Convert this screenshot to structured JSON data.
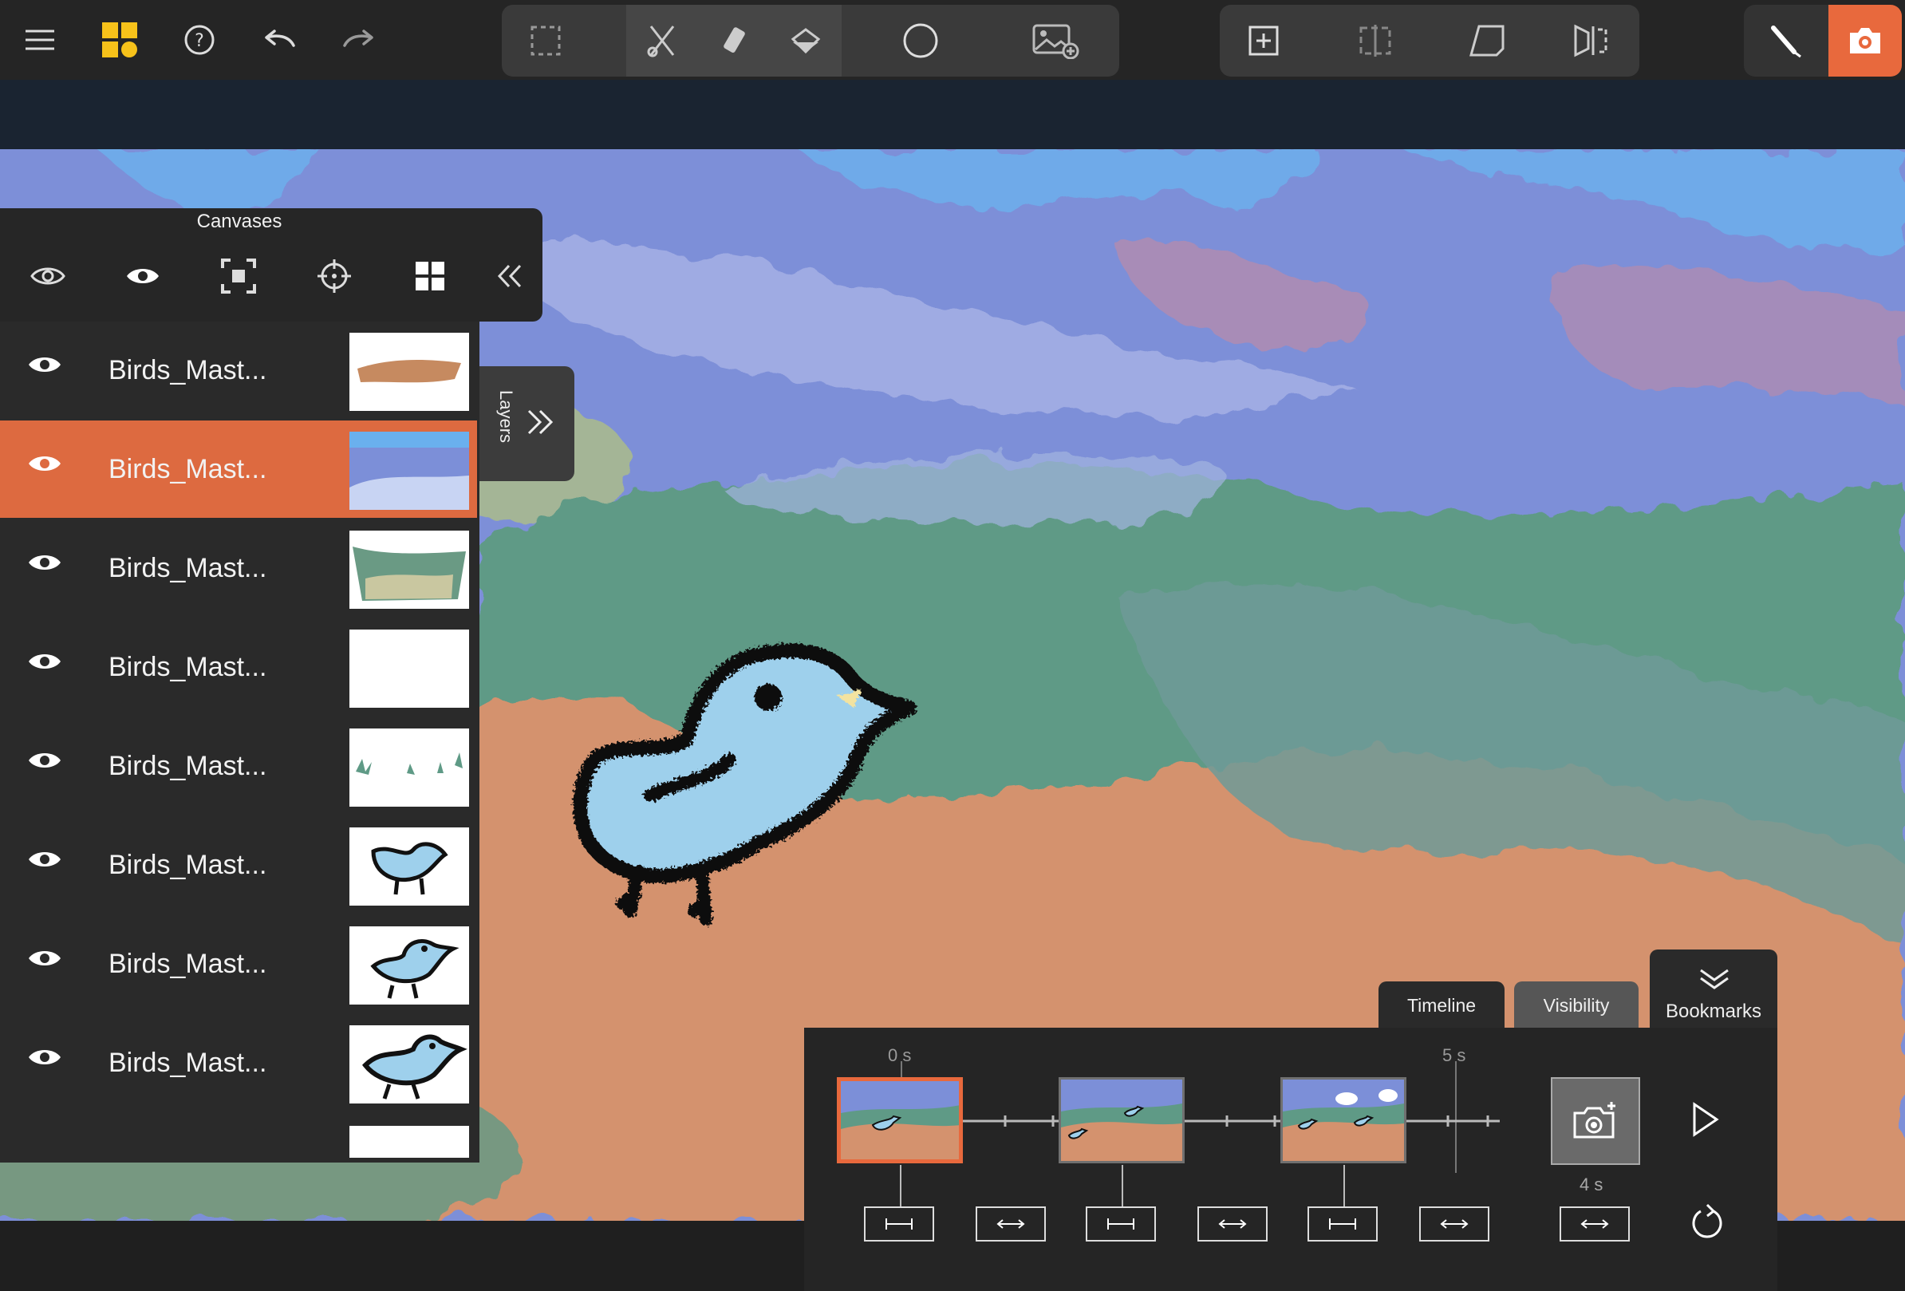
{
  "toolbar": {
    "left_icons": [
      "menu-icon",
      "app-logo-icon",
      "help-icon",
      "undo-icon",
      "redo-icon"
    ],
    "tools_group": [
      "selection-icon",
      "cut-icon",
      "eraser-icon",
      "fill-bucket-icon",
      "brush-size-icon",
      "add-image-icon"
    ],
    "canvas_group": [
      "add-canvas-icon",
      "split-canvas-icon",
      "transform-canvas-icon",
      "flip-canvas-icon"
    ],
    "right_icons": [
      "pencil-icon",
      "camera-icon"
    ],
    "accent": "#e8693d"
  },
  "canvases": {
    "title": "Canvases",
    "icons": [
      "visibility-toggle-icon",
      "eye-icon",
      "fit-screen-icon",
      "crosshair-icon",
      "grid-icon",
      "collapse-icon"
    ]
  },
  "layers": {
    "tab_label": "Layers",
    "items": [
      {
        "name": "Birds_Mast...",
        "selected": false
      },
      {
        "name": "Birds_Mast...",
        "selected": true
      },
      {
        "name": "Birds_Mast...",
        "selected": false
      },
      {
        "name": "Birds_Mast...",
        "selected": false
      },
      {
        "name": "Birds_Mast...",
        "selected": false
      },
      {
        "name": "Birds_Mast...",
        "selected": false
      },
      {
        "name": "Birds_Mast...",
        "selected": false
      },
      {
        "name": "Birds_Mast...",
        "selected": false
      }
    ]
  },
  "timeline": {
    "tabs": {
      "timeline": "Timeline",
      "visibility": "Visibility",
      "bookmarks": "Bookmarks"
    },
    "ticks": {
      "start": "0 s",
      "five": "5 s"
    },
    "snapshot_duration": "4 s"
  }
}
